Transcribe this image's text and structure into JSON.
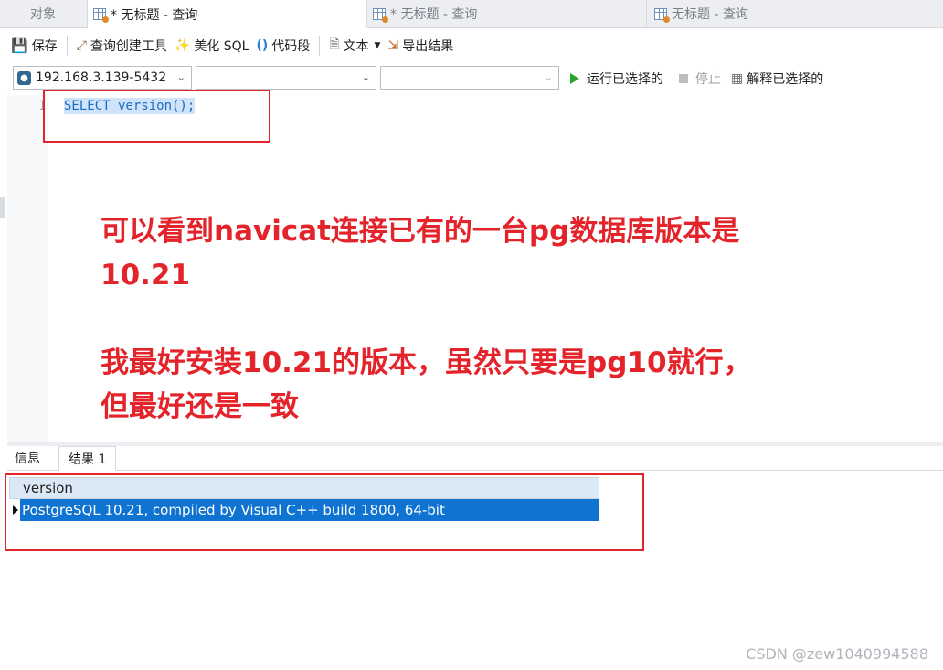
{
  "tabs": [
    {
      "label": "对象"
    },
    {
      "label": "* 无标题 - 查询"
    },
    {
      "label": "* 无标题 - 查询"
    },
    {
      "label": "无标题 - 查询"
    }
  ],
  "toolbar": {
    "save": "保存",
    "query_builder": "查询创建工具",
    "beautify_sql": "美化 SQL",
    "code_snippet": "代码段",
    "text": "文本",
    "export_result": "导出结果"
  },
  "connection": {
    "server": "192.168.3.139-5432",
    "database": "",
    "schema": ""
  },
  "run_bar": {
    "run_selected": "运行已选择的",
    "stop": "停止",
    "explain_selected": "解释已选择的"
  },
  "editor": {
    "line_number": "1",
    "sql": "SELECT version();"
  },
  "annotations": {
    "line1": "可以看到navicat连接已有的一台pg数据库版本是",
    "line2": "10.21",
    "line3": "我最好安装10.21的版本，虽然只要是pg10就行，",
    "line4": "但最好还是一致"
  },
  "results": {
    "tabs": [
      "信息",
      "结果 1"
    ],
    "column": "version",
    "rows": [
      "PostgreSQL 10.21, compiled by Visual C++ build 1800, 64-bit"
    ]
  },
  "watermark": "CSDN @zew1040994588",
  "colors": {
    "annotation_red": "#e3242b",
    "selection_blue": "#0f73d1",
    "run_green": "#2aa52e"
  }
}
